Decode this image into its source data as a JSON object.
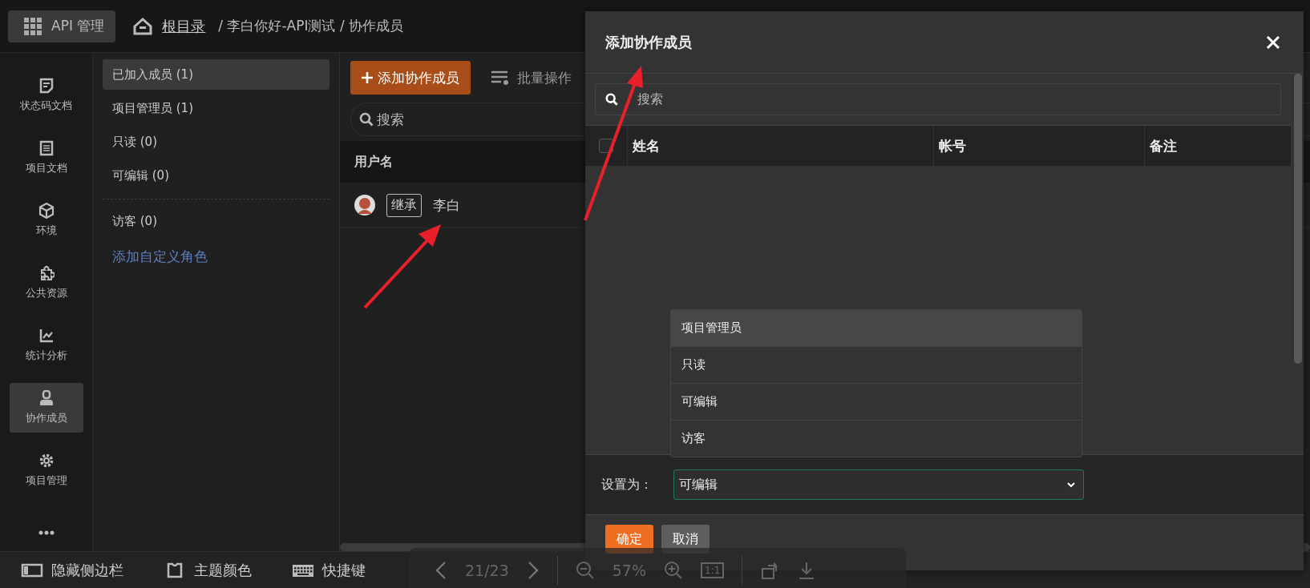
{
  "topbar": {
    "app_button": "API 管理",
    "root_link": "根目录",
    "path": "/ 李白你好-API测试 / 协作成员"
  },
  "sidebar": {
    "items": [
      {
        "label": "状态码文档",
        "selected": false
      },
      {
        "label": "项目文档",
        "selected": false
      },
      {
        "label": "环境",
        "selected": false
      },
      {
        "label": "公共资源",
        "selected": false
      },
      {
        "label": "统计分析",
        "selected": false
      },
      {
        "label": "协作成员",
        "selected": true
      },
      {
        "label": "项目管理",
        "selected": false
      },
      {
        "selected": false
      }
    ]
  },
  "roles": {
    "groups": [
      [
        {
          "label": "已加入成员 (1)",
          "selected": true
        },
        {
          "label": "项目管理员 (1)",
          "selected": false
        },
        {
          "label": "只读 (0)",
          "selected": false
        },
        {
          "label": "可编辑 (0)",
          "selected": false
        }
      ],
      [
        {
          "label": "访客 (0)",
          "selected": false
        }
      ]
    ],
    "custom_role_link": "添加自定义角色"
  },
  "members": {
    "add_button": "添加协作成员",
    "batch_button": "批量操作",
    "search": {
      "placeholder": "搜索"
    },
    "columns": [
      "用户名"
    ],
    "rows": [
      {
        "tag": "继承",
        "name": "李白"
      }
    ]
  },
  "bottom_bar": {
    "items": [
      "隐藏侧边栏",
      "主题颜色",
      "快捷键"
    ]
  },
  "viewer_toolbar": {
    "page": "21/23",
    "zoom": "57%",
    "actual_size": "1:1"
  },
  "dialog": {
    "title": "添加协作成员",
    "search": {
      "placeholder": "搜索"
    },
    "header_checked": false,
    "columns": [
      "姓名",
      "帐号",
      "备注"
    ],
    "menu": [
      {
        "label": "项目管理员",
        "highlighted": true
      },
      {
        "label": "只读",
        "highlighted": false
      },
      {
        "label": "可编辑",
        "highlighted": false
      },
      {
        "label": "访客",
        "highlighted": false
      }
    ],
    "role_label": "设置为：",
    "role_value": "可编辑",
    "buttons": [
      {
        "label": "确定",
        "kind": "primary"
      },
      {
        "label": "取消",
        "kind": "secondary"
      }
    ]
  }
}
